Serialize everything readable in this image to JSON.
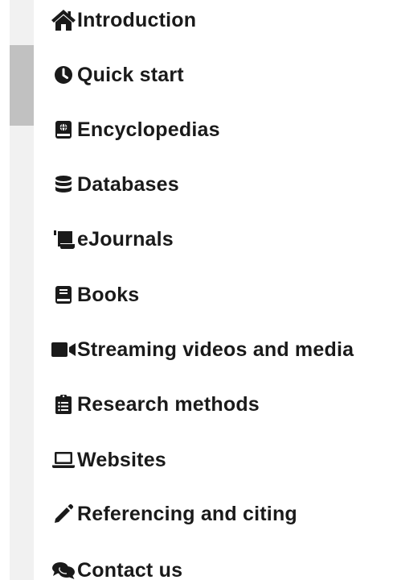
{
  "nav": {
    "items": [
      {
        "label": "Introduction",
        "icon": "home-icon"
      },
      {
        "label": "Quick start",
        "icon": "clock-icon"
      },
      {
        "label": "Encyclopedias",
        "icon": "book-globe-icon"
      },
      {
        "label": "Databases",
        "icon": "database-icon"
      },
      {
        "label": "eJournals",
        "icon": "scroll-icon"
      },
      {
        "label": "Books",
        "icon": "book-icon"
      },
      {
        "label": "Streaming videos and media",
        "icon": "video-camera-icon"
      },
      {
        "label": "Research methods",
        "icon": "clipboard-list-icon"
      },
      {
        "label": "Websites",
        "icon": "laptop-icon"
      },
      {
        "label": "Referencing and citing",
        "icon": "pencil-icon"
      },
      {
        "label": "Contact us",
        "icon": "comments-icon"
      }
    ]
  },
  "colors": {
    "text": "#1a1a1a",
    "scroll_track": "#f1f1f1",
    "scroll_thumb": "#c1c1c1"
  }
}
